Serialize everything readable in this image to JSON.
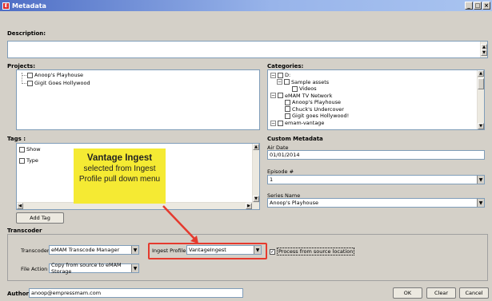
{
  "window": {
    "title": "Metadata",
    "app_icon": "E"
  },
  "description": {
    "label": "Description:",
    "value": ""
  },
  "projects": {
    "label": "Projects:",
    "items": [
      "Anoop's Playhouse",
      "Gigit Goes Hollywood"
    ]
  },
  "categories": {
    "label": "Categories:",
    "items": [
      {
        "label": "D:",
        "level": 0,
        "expander": "−"
      },
      {
        "label": "Sample assets",
        "level": 1,
        "expander": "−"
      },
      {
        "label": "Videos",
        "level": 2,
        "expander": ""
      },
      {
        "label": "eMAM TV Network",
        "level": 0,
        "expander": "−"
      },
      {
        "label": "Anoop's Playhouse",
        "level": 1,
        "expander": ""
      },
      {
        "label": "Chuck's Undercover",
        "level": 1,
        "expander": ""
      },
      {
        "label": "Gigit goes Hollywood!",
        "level": 1,
        "expander": ""
      },
      {
        "label": "emam-vantage",
        "level": 0,
        "expander": "−"
      }
    ]
  },
  "tags": {
    "label": "Tags :",
    "items": [
      "Show",
      "Type"
    ],
    "add_button": "Add Tag"
  },
  "custom_metadata": {
    "label": "Custom Metadata",
    "air_date": {
      "label": "Air Date",
      "value": "01/01/2014"
    },
    "episode": {
      "label": "Episode #",
      "value": "1"
    },
    "series": {
      "label": "Series Name",
      "value": "Anoop's Playhouse"
    }
  },
  "transcoder": {
    "label": "Transcoder",
    "transcoder_label": "Transcoder",
    "transcoder_value": "eMAM Transcode Manager",
    "ingest_label": "Ingest Profile",
    "ingest_value": "VantageIngest",
    "process_label": "Process from source location",
    "process_checked": true,
    "file_action_label": "File Action",
    "file_action_value": "Copy from source to eMAM Storage"
  },
  "author": {
    "label": "Author",
    "value": "anoop@empressmam.com"
  },
  "buttons": {
    "ok": "OK",
    "clear": "Clear",
    "cancel": "Cancel"
  },
  "callout": {
    "title": "Vantage Ingest",
    "body": "selected from Ingest Profile pull down menu",
    "color": "#f5ea33",
    "arrow_color": "#e53a2e"
  }
}
